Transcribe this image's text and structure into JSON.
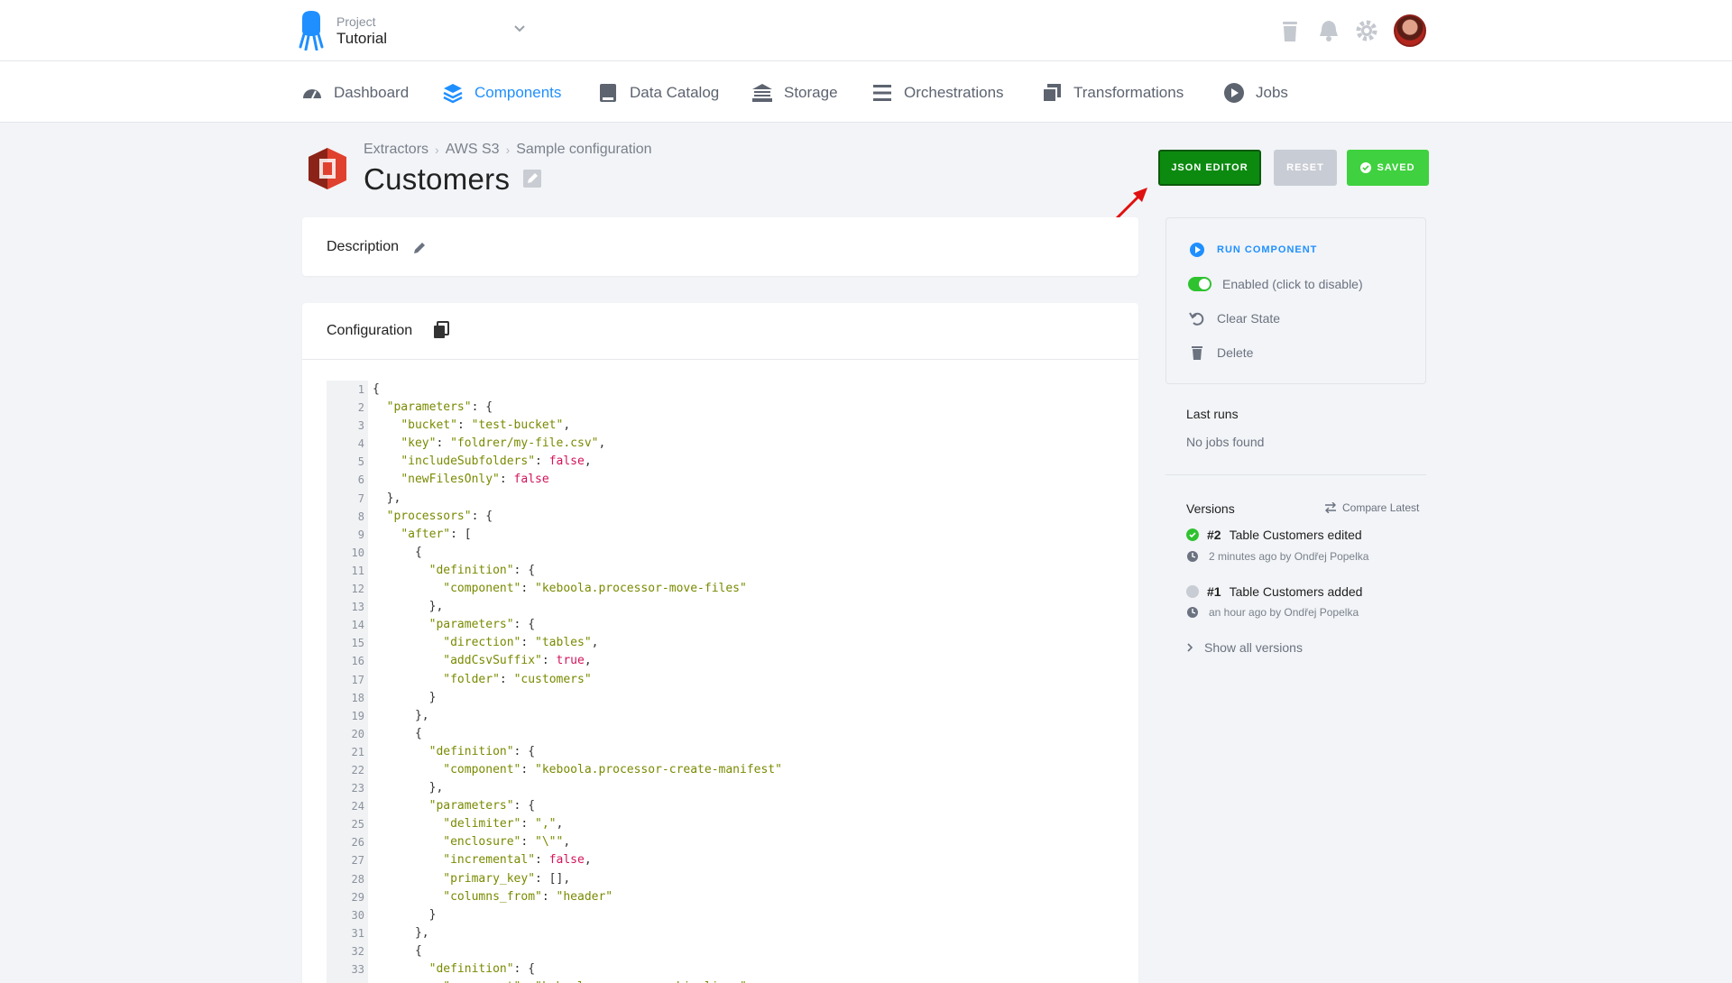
{
  "project": {
    "label": "Project",
    "name": "Tutorial"
  },
  "nav": {
    "items": [
      {
        "label": "Dashboard",
        "icon": "dashboard-icon"
      },
      {
        "label": "Components",
        "icon": "components-icon"
      },
      {
        "label": "Data Catalog",
        "icon": "data-catalog-icon"
      },
      {
        "label": "Storage",
        "icon": "storage-icon"
      },
      {
        "label": "Orchestrations",
        "icon": "orchestrations-icon"
      },
      {
        "label": "Transformations",
        "icon": "transformations-icon"
      },
      {
        "label": "Jobs",
        "icon": "jobs-icon"
      }
    ],
    "active": "Components"
  },
  "breadcrumb": [
    "Extractors",
    "AWS S3",
    "Sample configuration"
  ],
  "page_title": "Customers",
  "buttons": {
    "json_editor": "JSON EDITOR",
    "reset": "RESET",
    "saved": "SAVED"
  },
  "description": {
    "label": "Description"
  },
  "configuration": {
    "label": "Configuration",
    "lines": [
      "{",
      "  \"parameters\": {",
      "    \"bucket\": \"test-bucket\",",
      "    \"key\": \"foldrer/my-file.csv\",",
      "    \"includeSubfolders\": false,",
      "    \"newFilesOnly\": false",
      "  },",
      "  \"processors\": {",
      "    \"after\": [",
      "      {",
      "        \"definition\": {",
      "          \"component\": \"keboola.processor-move-files\"",
      "        },",
      "        \"parameters\": {",
      "          \"direction\": \"tables\",",
      "          \"addCsvSuffix\": true,",
      "          \"folder\": \"customers\"",
      "        }",
      "      },",
      "      {",
      "        \"definition\": {",
      "          \"component\": \"keboola.processor-create-manifest\"",
      "        },",
      "        \"parameters\": {",
      "          \"delimiter\": \",\",",
      "          \"enclosure\": \"\\\"\",",
      "          \"incremental\": false,",
      "          \"primary_key\": [],",
      "          \"columns_from\": \"header\"",
      "        }",
      "      },",
      "      {",
      "        \"definition\": {",
      "          \"component\": \"keboola.processor-skip-lines\""
    ]
  },
  "sidebar": {
    "actions": {
      "run": "RUN COMPONENT",
      "enabled": "Enabled (click to disable)",
      "clear_state": "Clear State",
      "delete": "Delete"
    },
    "last_runs": {
      "title": "Last runs",
      "empty": "No jobs found"
    },
    "versions": {
      "title": "Versions",
      "compare": "Compare Latest",
      "items": [
        {
          "number": "#2",
          "text": "Table Customers edited",
          "meta": "2 minutes ago by Ondřej Popelka",
          "status_color": "#2fc22f"
        },
        {
          "number": "#1",
          "text": "Table Customers added",
          "meta": "an hour ago by Ondřej Popelka",
          "status_color": "#c8ccd4"
        }
      ],
      "show_all": "Show all versions"
    }
  },
  "colors": {
    "accent": "#1f8fff",
    "json_editor": "#0c8a10",
    "saved": "#3fd13f",
    "reset": "#c8ccd4",
    "s3": "#e0412f"
  }
}
